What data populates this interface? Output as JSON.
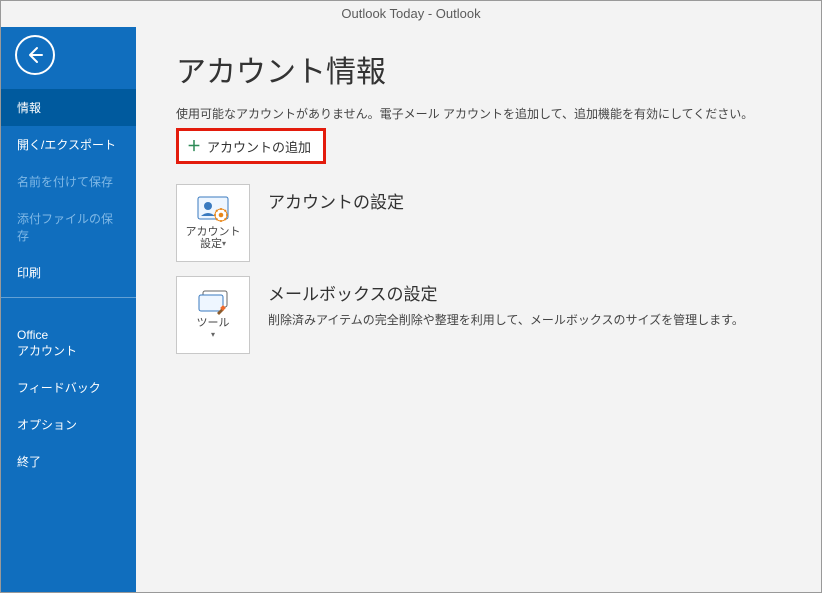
{
  "titlebar": "Outlook Today  -  Outlook",
  "sidebar": {
    "items": [
      {
        "label": "情報",
        "state": "selected"
      },
      {
        "label": "開く/エクスポート",
        "state": "normal"
      },
      {
        "label": "名前を付けて保存",
        "state": "disabled"
      },
      {
        "label": "添付ファイルの保存",
        "state": "disabled"
      },
      {
        "label": "印刷",
        "state": "normal"
      }
    ],
    "items2": [
      {
        "label": "Office\nアカウント"
      },
      {
        "label": "フィードバック"
      },
      {
        "label": "オプション"
      },
      {
        "label": "終了"
      }
    ]
  },
  "page": {
    "title": "アカウント情報",
    "info_text": "使用可能なアカウントがありません。電子メール アカウントを追加して、追加機能を有効にしてください。",
    "add_account_label": "アカウントの追加",
    "sections": [
      {
        "tile_label": "アカウント\n設定",
        "title": "アカウントの設定",
        "desc": ""
      },
      {
        "tile_label": "ツール",
        "title": "メールボックスの設定",
        "desc": "削除済みアイテムの完全削除や整理を利用して、メールボックスのサイズを管理します。"
      }
    ]
  }
}
